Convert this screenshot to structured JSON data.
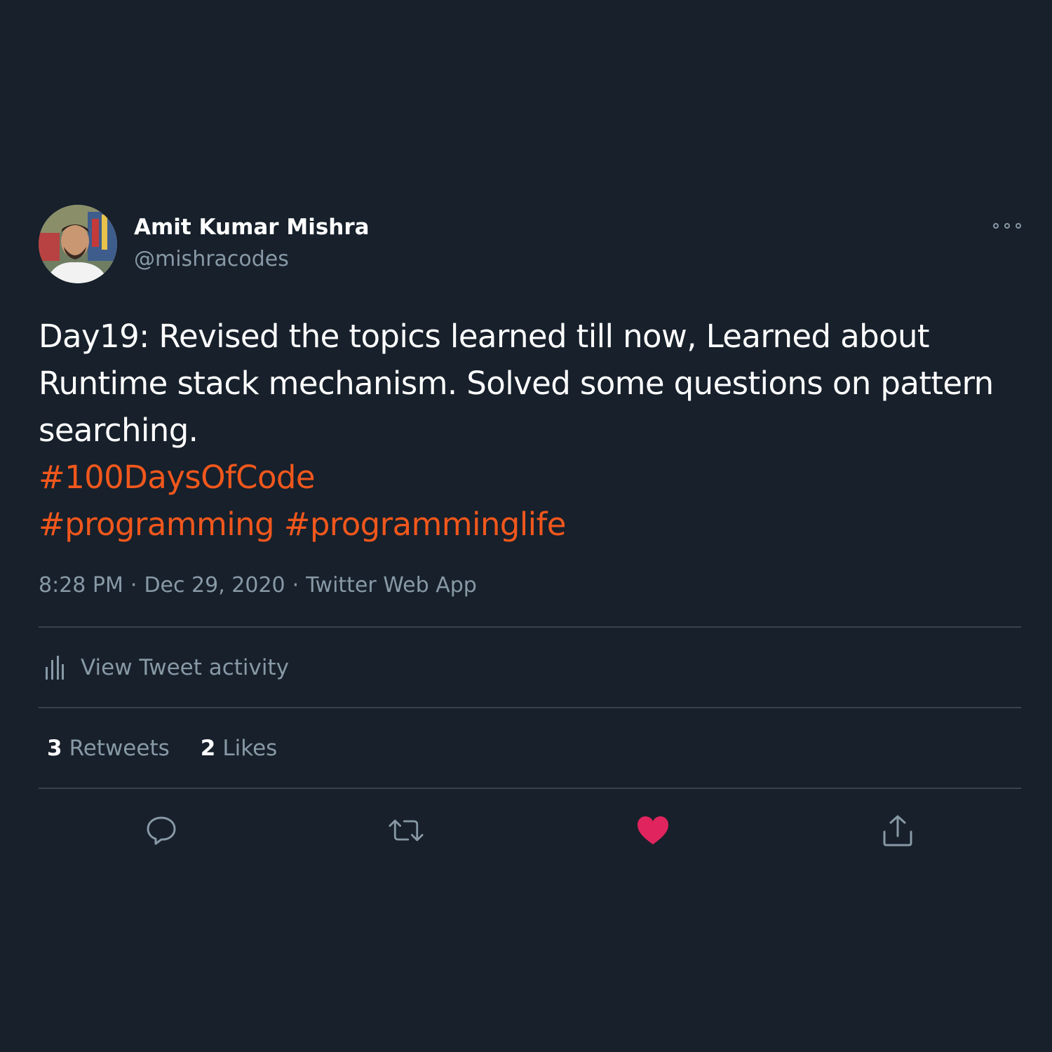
{
  "tweet": {
    "author_name": "Amit Kumar Mishra",
    "author_handle": "@mishracodes",
    "text": "Day19: Revised the topics learned till now, Learned about Runtime stack mechanism. Solved some questions on pattern searching.",
    "hashtags_line1": "#100DaysOfCode",
    "hashtags_line2": "#programming #programminglife",
    "time": "8:28 PM",
    "date": "Dec 29, 2020",
    "source": "Twitter Web App",
    "separator": "·"
  },
  "activity": {
    "label": "View Tweet activity",
    "icon": "bar-chart-icon"
  },
  "stats": {
    "retweets_count": "3",
    "retweets_label": "Retweets",
    "likes_count": "2",
    "likes_label": "Likes"
  },
  "actions": {
    "icons": [
      "reply-icon",
      "retweet-icon",
      "heart-icon",
      "share-icon"
    ],
    "liked": true
  },
  "colors": {
    "background": "#17202b",
    "text": "#ffffff",
    "secondary": "#8899a6",
    "hashtag": "#f1571c",
    "like": "#e0245e",
    "divider": "#38444d"
  }
}
